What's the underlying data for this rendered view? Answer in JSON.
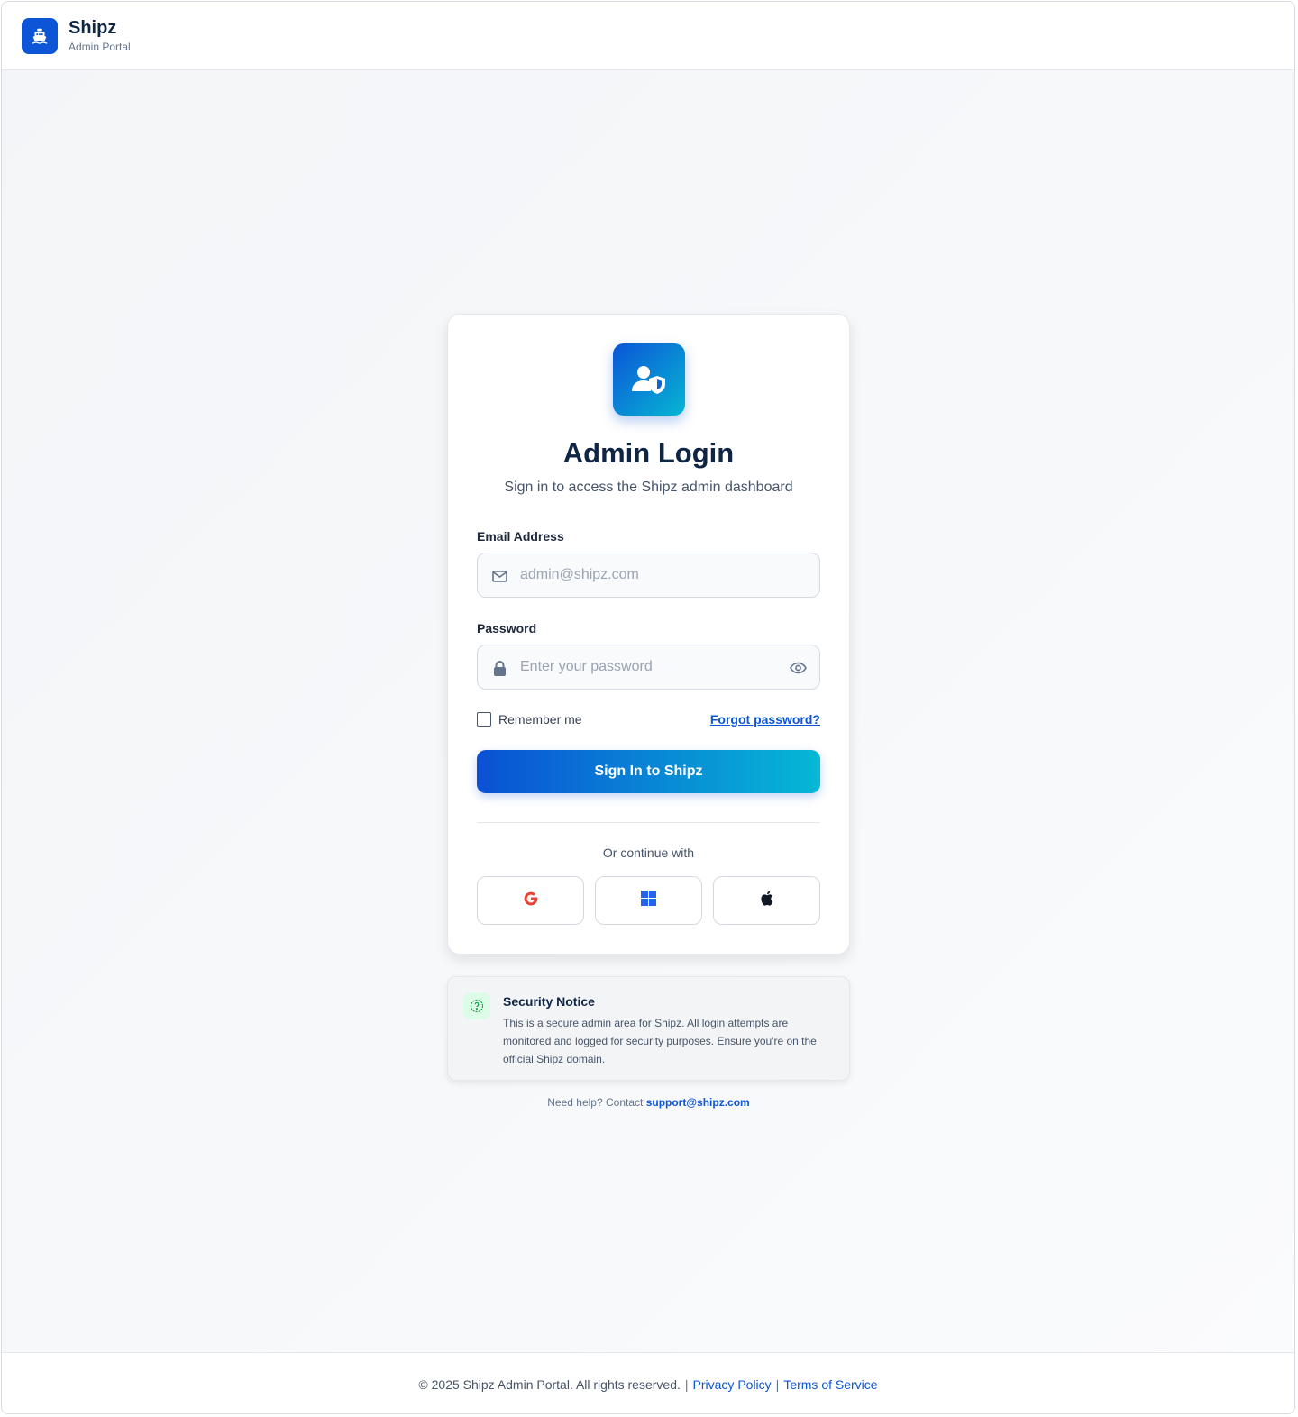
{
  "header": {
    "brand_name": "Shipz",
    "brand_subtitle": "Admin Portal",
    "logo_icon": "ship-icon"
  },
  "login": {
    "hero_icon": "user-shield-icon",
    "title": "Admin Login",
    "subtitle": "Sign in to access the Shipz admin dashboard",
    "email_label": "Email Address",
    "email_placeholder": "admin@shipz.com",
    "email_value": "",
    "password_label": "Password",
    "password_placeholder": "Enter your password",
    "password_value": "",
    "remember_label": "Remember me",
    "remember_checked": false,
    "forgot_label": "Forgot password?",
    "signin_label": "Sign In to Shipz",
    "continue_label": "Or continue with",
    "social_providers": [
      "google-icon",
      "windows-icon",
      "apple-icon"
    ]
  },
  "notice": {
    "title": "Security Notice",
    "text": "This is a secure admin area for Shipz. All login attempts are monitored and logged for security purposes. Ensure you're on the official Shipz domain."
  },
  "help": {
    "prefix": "Need help? Contact",
    "email": "support@shipz.com"
  },
  "footer": {
    "copyright": "© 2025 Shipz Admin Portal. All rights reserved.",
    "privacy": "Privacy Policy",
    "terms": "Terms of Service",
    "separator": "|"
  },
  "colors": {
    "primary": "#0b55d6",
    "accent": "#06b6d4",
    "heading": "#0f2544",
    "notice_icon_bg": "#dcfce7",
    "google_red": "#ea4335",
    "windows_blue": "#2563eb"
  }
}
